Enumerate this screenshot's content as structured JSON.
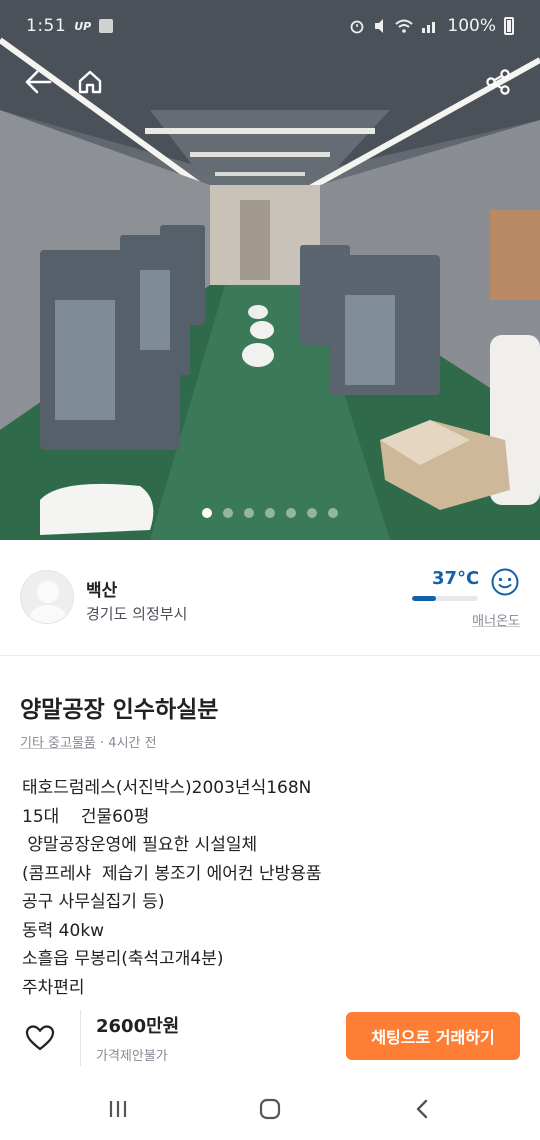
{
  "status_bar": {
    "time": "1:51",
    "badges": [
      "UP"
    ],
    "battery": "100%"
  },
  "nav": {
    "back_icon": "back-arrow-icon",
    "home_icon": "home-icon",
    "share_icon": "share-icon"
  },
  "carousel": {
    "total": 7,
    "active_index": 0
  },
  "seller": {
    "name": "백산",
    "location": "경기도 의정부시",
    "temperature": "37°C",
    "temperature_level": 0.37,
    "manner_label": "매너온도"
  },
  "article": {
    "title": "양말공장 인수하실분",
    "category": "기타 중고물품",
    "time_ago": "· 4시간 전",
    "description": "태호드럼레스(서진박스)2003년식168N\n15대    건물60평\n 양말공장운영에 필요한 시설일체\n(콤프레샤  제습기 봉조기 에어컨 난방용품\n공구 사무실집기 등)\n동력 40kw\n소흘읍 무봉리(축석고개4분)\n주차편리"
  },
  "bottom": {
    "price": "2600만원",
    "negotiation": "가격제안불가",
    "chat_button": "채팅으로 거래하기"
  },
  "colors": {
    "accent": "#ff7e36",
    "temperature": "#1561a9",
    "muted_text": "#868b94"
  }
}
